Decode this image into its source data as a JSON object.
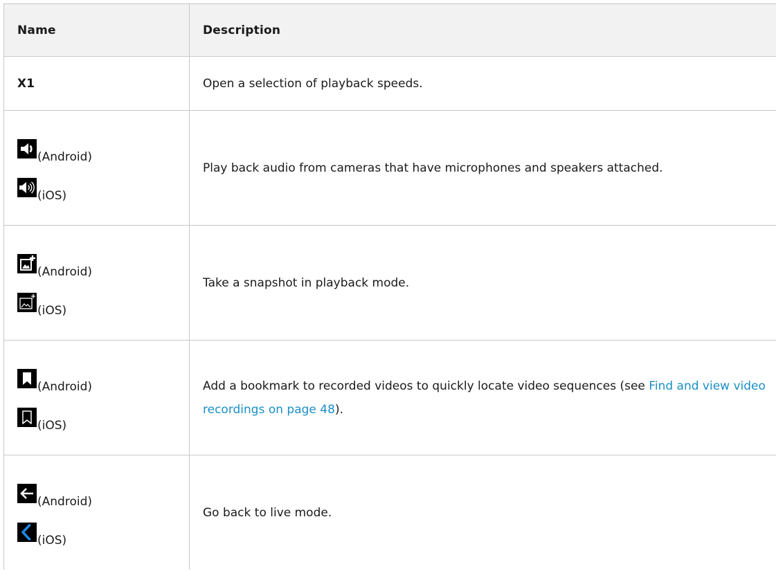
{
  "table": {
    "headers": {
      "name": "Name",
      "description": "Description"
    },
    "rows": [
      {
        "name": "X1",
        "description": "Open a selection of playback speeds."
      },
      {
        "android_icon": "speaker-icon",
        "android_label": "(Android)",
        "ios_icon": "speaker-waves-icon",
        "ios_label": "(iOS)",
        "description": "Play back audio from cameras that have microphones and speakers attached."
      },
      {
        "android_icon": "snapshot-add-icon",
        "android_label": "(Android)",
        "ios_icon": "snapshot-add-outline-icon",
        "ios_label": "(iOS)",
        "description": "Take a snapshot in playback mode."
      },
      {
        "android_icon": "bookmark-icon",
        "android_label": "(Android)",
        "ios_icon": "bookmark-outline-icon",
        "ios_label": "(iOS)",
        "description_prefix": "Add a bookmark to recorded videos to quickly locate video sequences (see ",
        "description_link": "Find and view video recordings on page 48",
        "description_suffix": ")."
      },
      {
        "android_icon": "arrow-back-icon",
        "android_label": "(Android)",
        "ios_icon": "chevron-back-icon",
        "ios_label": "(iOS)",
        "description": "Go back to live mode."
      }
    ]
  },
  "colors": {
    "link": "#1a8fc6",
    "header_bg": "#f2f2f2",
    "border": "#c8c8c8",
    "ios_back_icon": "#1e88e5"
  }
}
